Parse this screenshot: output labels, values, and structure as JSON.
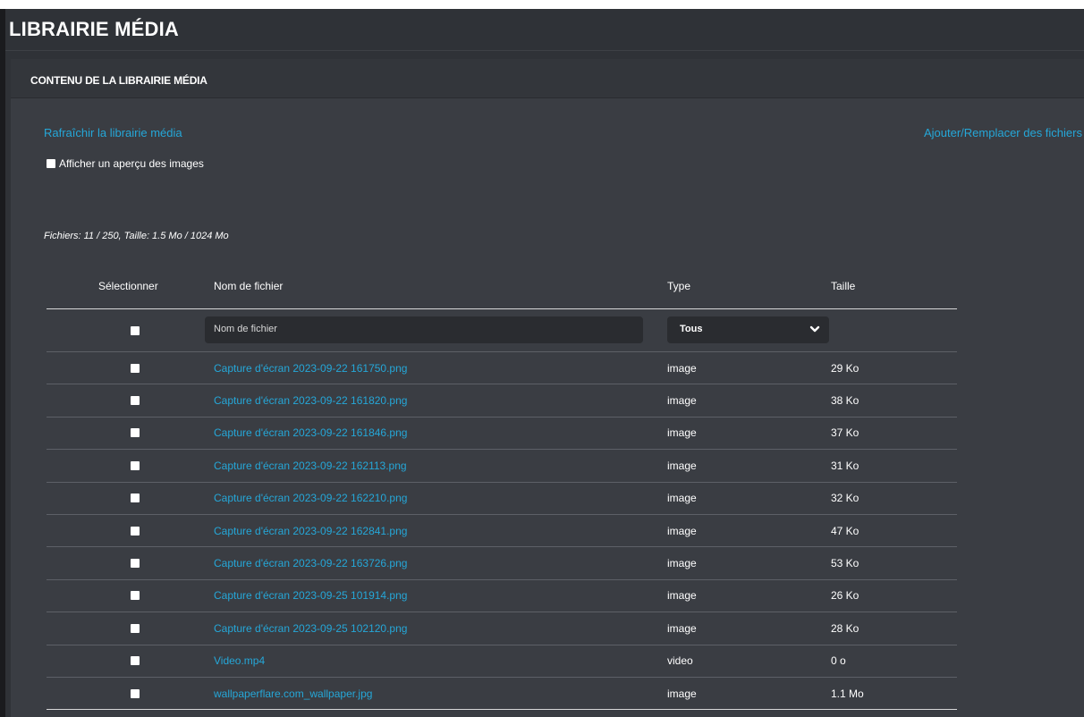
{
  "header": {
    "title": "LIBRAIRIE MÉDIA"
  },
  "panel": {
    "title": "CONTENU DE LA LIBRAIRIE MÉDIA",
    "refresh_link": "Rafraîchir la librairie média",
    "upload_link": "Ajouter/Remplacer des fichiers",
    "preview_checkbox_label": "Afficher un aperçu des images",
    "preview_checked": false,
    "stats": "Fichiers: 11 / 250, Taille: 1.5 Mo / 1024 Mo"
  },
  "table": {
    "columns": {
      "select": "Sélectionner",
      "name": "Nom de fichier",
      "type": "Type",
      "size": "Taille"
    },
    "filter": {
      "name_placeholder": "Nom de fichier",
      "type_selected": "Tous"
    },
    "rows": [
      {
        "name": "Capture d'écran 2023-09-22 161750.png",
        "type": "image",
        "size": "29 Ko"
      },
      {
        "name": "Capture d'écran 2023-09-22 161820.png",
        "type": "image",
        "size": "38 Ko"
      },
      {
        "name": "Capture d'écran 2023-09-22 161846.png",
        "type": "image",
        "size": "37 Ko"
      },
      {
        "name": "Capture d'écran 2023-09-22 162113.png",
        "type": "image",
        "size": "31 Ko"
      },
      {
        "name": "Capture d'écran 2023-09-22 162210.png",
        "type": "image",
        "size": "32 Ko"
      },
      {
        "name": "Capture d'écran 2023-09-22 162841.png",
        "type": "image",
        "size": "47 Ko"
      },
      {
        "name": "Capture d'écran 2023-09-22 163726.png",
        "type": "image",
        "size": "53 Ko"
      },
      {
        "name": "Capture d'écran 2023-09-25 101914.png",
        "type": "image",
        "size": "26 Ko"
      },
      {
        "name": "Capture d'écran 2023-09-25 102120.png",
        "type": "image",
        "size": "28 Ko"
      },
      {
        "name": "Video.mp4",
        "type": "video",
        "size": "0 o"
      },
      {
        "name": "wallpaperflare.com_wallpaper.jpg",
        "type": "image",
        "size": "1.1 Mo"
      }
    ]
  },
  "colors": {
    "background": "#2f3237",
    "panel": "#3a3d43",
    "link": "#25a7d8",
    "text": "#ffffff"
  },
  "icons": {
    "select_chevron": "chevron-down-icon"
  }
}
